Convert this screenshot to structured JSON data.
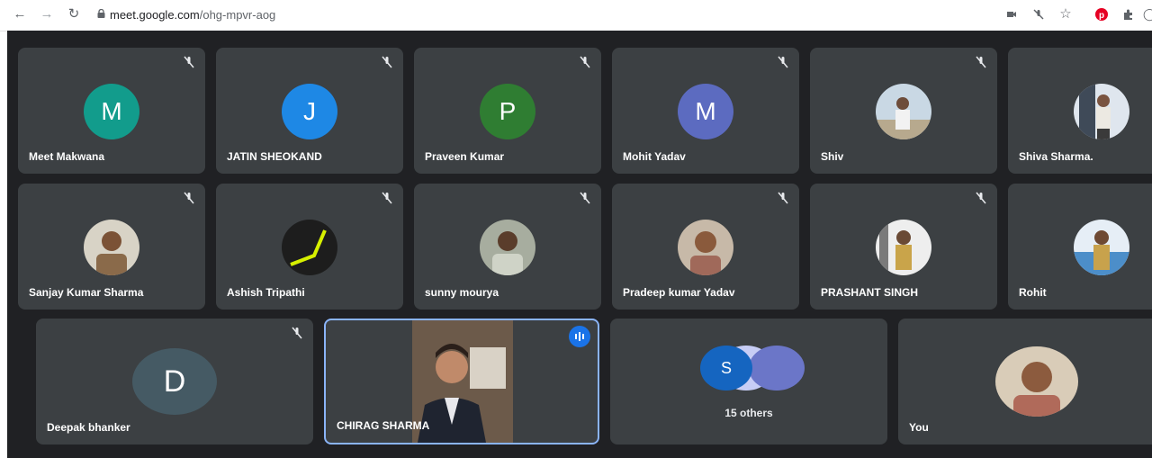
{
  "browser": {
    "url_domain": "meet.google.com",
    "url_path": "/ohg-mpvr-aog",
    "icons": [
      "back-icon",
      "forward-icon",
      "reload-icon",
      "lock-icon",
      "camera-icon",
      "mic-off-icon",
      "star-icon",
      "pinterest-icon",
      "extensions-icon"
    ]
  },
  "participants": {
    "meet_makwana": {
      "name": "Meet Makwana",
      "initial": "M",
      "color": "#129c8c"
    },
    "jatin": {
      "name": "JATIN SHEOKAND",
      "initial": "J",
      "color": "#1e88e5"
    },
    "praveen": {
      "name": "Praveen Kumar",
      "initial": "P",
      "color": "#2f7d32"
    },
    "mohit": {
      "name": "Mohit Yadav",
      "initial": "M",
      "color": "#5c6bc0"
    },
    "shiv": {
      "name": "Shiv"
    },
    "shiva": {
      "name": "Shiva Sharma."
    },
    "sanjay": {
      "name": "Sanjay Kumar Sharma"
    },
    "ashish": {
      "name": "Ashish Tripathi"
    },
    "sunny": {
      "name": "sunny mourya"
    },
    "pradeep": {
      "name": "Pradeep kumar Yadav"
    },
    "prashant": {
      "name": "PRASHANT SINGH"
    },
    "rohit": {
      "name": "Rohit"
    },
    "deepak": {
      "name": "Deepak bhanker",
      "initial": "D",
      "color": "#455a64"
    },
    "chirag": {
      "name": "CHIRAG SHARMA"
    },
    "others": {
      "label": "15 others",
      "initial": "S",
      "color": "#1565c0"
    },
    "you": {
      "name": "You"
    }
  },
  "colors": {
    "meet_bg": "#202124",
    "tile_bg": "#3c4043",
    "active_border": "#8ab4f8",
    "speaking": "#1a73e8"
  }
}
